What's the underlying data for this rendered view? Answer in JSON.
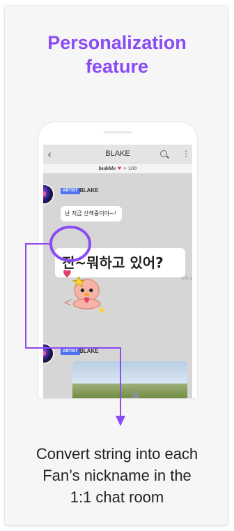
{
  "title": {
    "line1": "Personalization",
    "line2": "feature"
  },
  "phone": {
    "app_title": "BLAKE",
    "bubble_word": "bubble",
    "bubble_count": "+ 100",
    "artist_tag": "ARTIST",
    "artist_name": "BLAKE",
    "message1": "난 지금 산책중이야~!",
    "message2": "진~뭐하고 있어?",
    "timestamp": "오후 05:58",
    "artist_tag2": "ARTIST",
    "artist_name2": "BLAKE"
  },
  "caption": {
    "line1": "Convert string into each",
    "line2": "Fan’s nickname in the",
    "line3": "1:1 chat room"
  },
  "colors": {
    "accent": "#8a4bf5",
    "artist_tag": "#4f73f0"
  }
}
